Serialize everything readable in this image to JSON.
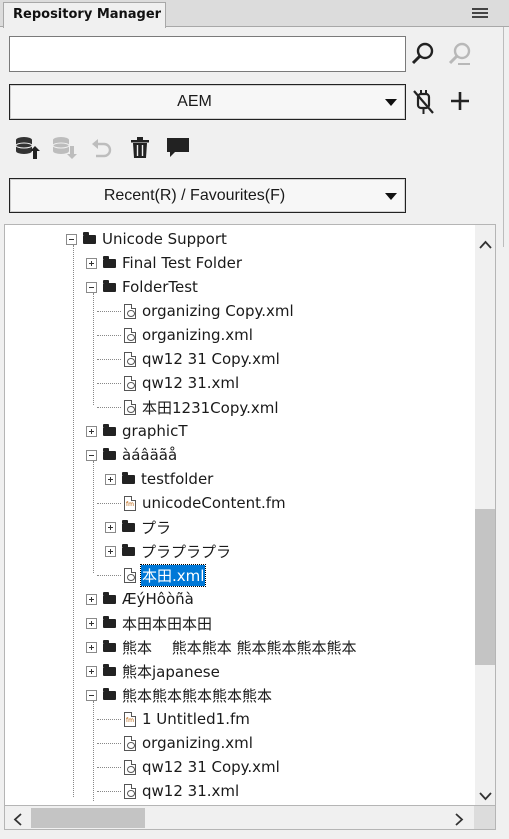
{
  "panel": {
    "title": "Repository Manager",
    "menu_icon": "hamburger-menu-icon"
  },
  "search": {
    "value": "",
    "search_icon": "search-icon",
    "advanced_icon": "advanced-search-icon"
  },
  "connection": {
    "selected": "AEM",
    "disconnect_icon": "disconnect-plug-icon",
    "add_icon": "plus-icon"
  },
  "toolbar": {
    "icons": [
      "checkin-icon",
      "checkout-icon",
      "undo-icon",
      "delete-icon",
      "comment-icon"
    ]
  },
  "filter": {
    "selected": "Recent(R) / Favourites(F)"
  },
  "tree": {
    "rows": [
      {
        "label": "Unicode Support",
        "kind": "folder",
        "expanded": true
      },
      {
        "label": "Final Test Folder",
        "kind": "folder",
        "expanded": false
      },
      {
        "label": "FolderTest",
        "kind": "folder",
        "expanded": true
      },
      {
        "label": "organizing Copy.xml",
        "kind": "xml"
      },
      {
        "label": "organizing.xml",
        "kind": "xml"
      },
      {
        "label": "qw12 31 Copy.xml",
        "kind": "xml"
      },
      {
        "label": "qw12 31.xml",
        "kind": "xml"
      },
      {
        "label": "本田1231Copy.xml",
        "kind": "xml"
      },
      {
        "label": "graphicT",
        "kind": "folder",
        "expanded": false
      },
      {
        "label": "àáâäãå",
        "kind": "folder",
        "expanded": true
      },
      {
        "label": "testfolder",
        "kind": "folder",
        "expanded": false
      },
      {
        "label": "unicodeContent.fm",
        "kind": "fm"
      },
      {
        "label": "プラ",
        "kind": "folder",
        "expanded": false
      },
      {
        "label": "プラプラプラ",
        "kind": "folder",
        "expanded": false
      },
      {
        "label": "本田.xml",
        "kind": "xml",
        "selected": true
      },
      {
        "label": "ÆýHôòñà",
        "kind": "folder",
        "expanded": false
      },
      {
        "label": "本田本田本田",
        "kind": "folder",
        "expanded": false
      },
      {
        "label": "熊本　 熊本熊本 熊本熊本熊本熊本",
        "kind": "folder",
        "expanded": false
      },
      {
        "label": "熊本japanese",
        "kind": "folder",
        "expanded": false
      },
      {
        "label": "熊本熊本熊本熊本熊本",
        "kind": "folder",
        "expanded": true
      },
      {
        "label": "1 Untitled1.fm",
        "kind": "fm"
      },
      {
        "label": "organizing.xml",
        "kind": "xml"
      },
      {
        "label": "qw12 31 Copy.xml",
        "kind": "xml"
      },
      {
        "label": "qw12 31.xml",
        "kind": "xml"
      }
    ]
  },
  "colors": {
    "selection": "#0078d7",
    "background": "#f0f0f0"
  }
}
